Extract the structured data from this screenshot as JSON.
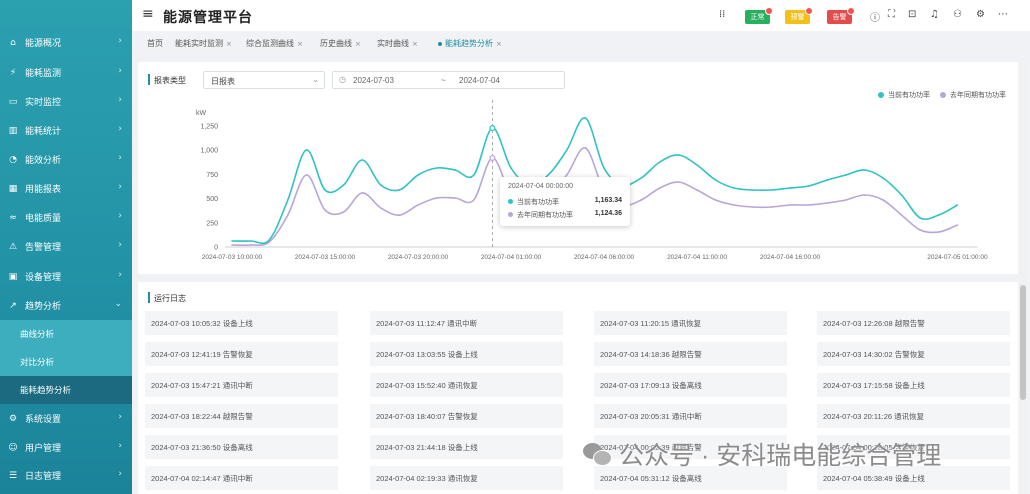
{
  "header": {
    "title": "能源管理平台",
    "badges": [
      {
        "label": "正常",
        "color": "#27b15f"
      },
      {
        "label": "预警",
        "color": "#f2c01a"
      },
      {
        "label": "告警",
        "color": "#e44b4b"
      }
    ],
    "icons": [
      "grid-icon",
      "info-icon",
      "expand-icon",
      "lock-icon",
      "bell-icon",
      "user-icon",
      "settings-icon"
    ]
  },
  "sidebar": {
    "items": [
      {
        "label": "能源概况",
        "icon": "home-icon"
      },
      {
        "label": "能耗监测",
        "icon": "bolt-icon"
      },
      {
        "label": "实时监控",
        "icon": "monitor-icon"
      },
      {
        "label": "能耗统计",
        "icon": "bar-chart-icon"
      },
      {
        "label": "能效分析",
        "icon": "pie-chart-icon"
      },
      {
        "label": "用能报表",
        "icon": "table-icon"
      },
      {
        "label": "电能质量",
        "icon": "wave-icon"
      },
      {
        "label": "告警管理",
        "icon": "warning-icon"
      },
      {
        "label": "设备管理",
        "icon": "device-icon"
      },
      {
        "label": "趋势分析",
        "icon": "trend-icon"
      },
      {
        "label": "系统设置",
        "icon": "gear-icon"
      },
      {
        "label": "用户管理",
        "icon": "user-icon"
      },
      {
        "label": "日志管理",
        "icon": "document-icon"
      }
    ],
    "submenu": [
      {
        "label": "曲线分析"
      },
      {
        "label": "对比分析"
      },
      {
        "label": "能耗趋势分析",
        "active": true
      }
    ]
  },
  "tabs": [
    {
      "label": "首页"
    },
    {
      "label": "能耗实时监测"
    },
    {
      "label": "综合监测曲线"
    },
    {
      "label": "历史曲线"
    },
    {
      "label": "实时曲线"
    },
    {
      "label": "能耗趋势分析",
      "active": true
    }
  ],
  "chart_panel": {
    "filter_label": "报表类型",
    "report_type": "日报表",
    "date_start": "2024-07-03",
    "date_sep": "~",
    "date_end": "2024-07-04"
  },
  "chart_data": {
    "type": "line",
    "title": "",
    "xlabel": "",
    "ylabel": "",
    "yname": "kW",
    "grid": false,
    "legend": "top-right",
    "smooth": true,
    "ylim": [
      0,
      1400
    ],
    "yticks": [
      0,
      250,
      500,
      750,
      1000,
      1250
    ],
    "ytick_labels": [
      "0",
      "250",
      "500",
      "750",
      "1,000",
      "1,250"
    ],
    "x": [
      "2024-07-03 10:00:00",
      "2024-07-03 11:00:00",
      "2024-07-03 12:00:00",
      "2024-07-03 13:00:00",
      "2024-07-03 14:00:00",
      "2024-07-03 15:00:00",
      "2024-07-03 16:00:00",
      "2024-07-03 17:00:00",
      "2024-07-03 18:00:00",
      "2024-07-03 19:00:00",
      "2024-07-03 20:00:00",
      "2024-07-03 21:00:00",
      "2024-07-03 22:00:00",
      "2024-07-03 23:00:00",
      "2024-07-04 00:00:00",
      "2024-07-04 01:00:00",
      "2024-07-04 02:00:00",
      "2024-07-04 03:00:00",
      "2024-07-04 04:00:00",
      "2024-07-04 05:00:00",
      "2024-07-04 06:00:00",
      "2024-07-04 07:00:00",
      "2024-07-04 08:00:00",
      "2024-07-04 09:00:00",
      "2024-07-04 10:00:00",
      "2024-07-04 11:00:00",
      "2024-07-04 12:00:00",
      "2024-07-04 13:00:00",
      "2024-07-04 14:00:00",
      "2024-07-04 15:00:00",
      "2024-07-04 16:00:00",
      "2024-07-04 17:00:00",
      "2024-07-04 18:00:00",
      "2024-07-04 19:00:00",
      "2024-07-04 20:00:00",
      "2024-07-04 21:00:00",
      "2024-07-04 22:00:00",
      "2024-07-04 23:00:00",
      "2024-07-05 00:00:00",
      "2024-07-05 01:00:00"
    ],
    "x_tick_labels": [
      "2024-07-03 10:00:00",
      "2024-07-03 15:00:00",
      "2024-07-03 20:00:00",
      "2024-07-04 01:00:00",
      "2024-07-04 06:00:00",
      "2024-07-04 11:00:00",
      "2024-07-04 16:00:00",
      "2024-07-05 01:00:00"
    ],
    "series": [
      {
        "name": "当前有功功率",
        "color": "#2fc2c4",
        "values": [
          62,
          62,
          72,
          486,
          1002,
          589,
          641,
          899,
          641,
          589,
          744,
          816,
          795,
          744,
          1229,
          816,
          641,
          744,
          1002,
          1333,
          816,
          641,
          713,
          878,
          950,
          847,
          692,
          609,
          589,
          589,
          609,
          630,
          692,
          744,
          795,
          713,
          537,
          300,
          331,
          434
        ]
      },
      {
        "name": "去年同期有功功率",
        "color": "#b7a6d8",
        "values": [
          21,
          21,
          52,
          330,
          744,
          382,
          362,
          558,
          403,
          330,
          434,
          506,
          506,
          486,
          920,
          537,
          434,
          537,
          744,
          1023,
          589,
          434,
          486,
          609,
          671,
          589,
          486,
          434,
          413,
          413,
          434,
          434,
          455,
          486,
          537,
          486,
          330,
          176,
          155,
          227
        ]
      }
    ]
  },
  "tooltip": {
    "time": "2024-07-04 00:00:00",
    "values": [
      "1,163.34",
      "1,124.36"
    ]
  },
  "log_panel": {
    "title": "运行日志",
    "entries": [
      "2024-07-03 10:05:32 设备上线",
      "2024-07-03 11:12:47 通讯中断",
      "2024-07-03 11:20:15 通讯恢复",
      "2024-07-03 12:26:08 越限告警",
      "2024-07-03 12:41:19 告警恢复",
      "2024-07-03 13:03:55 设备上线",
      "2024-07-03 14:18:36 越限告警",
      "2024-07-03 14:30:02 告警恢复",
      "2024-07-03 15:47:21 通讯中断",
      "2024-07-03 15:52:40 通讯恢复",
      "2024-07-03 17:09:13 设备离线",
      "2024-07-03 17:15:58 设备上线",
      "2024-07-03 18:22:44 越限告警",
      "2024-07-03 18:40:07 告警恢复",
      "2024-07-03 20:05:31 通讯中断",
      "2024-07-03 20:11:26 通讯恢复",
      "2024-07-03 21:36:50 设备离线",
      "2024-07-03 21:44:18 设备上线",
      "2024-07-04 00:02:39 越限告警",
      "2024-07-04 00:28:05 告警恢复",
      "2024-07-04 02:14:47 通讯中断",
      "2024-07-04 02:19:33 通讯恢复",
      "2024-07-04 05:31:12 设备离线",
      "2024-07-04 05:38:49 设备上线"
    ]
  },
  "watermark": {
    "text": "公众号 · 安科瑞电能综合管理"
  },
  "colors": {
    "sidebar": "#2394a7",
    "accent": "#1e8fa0",
    "submenu": "#3caebd",
    "submenu_active": "#1b6a80"
  }
}
